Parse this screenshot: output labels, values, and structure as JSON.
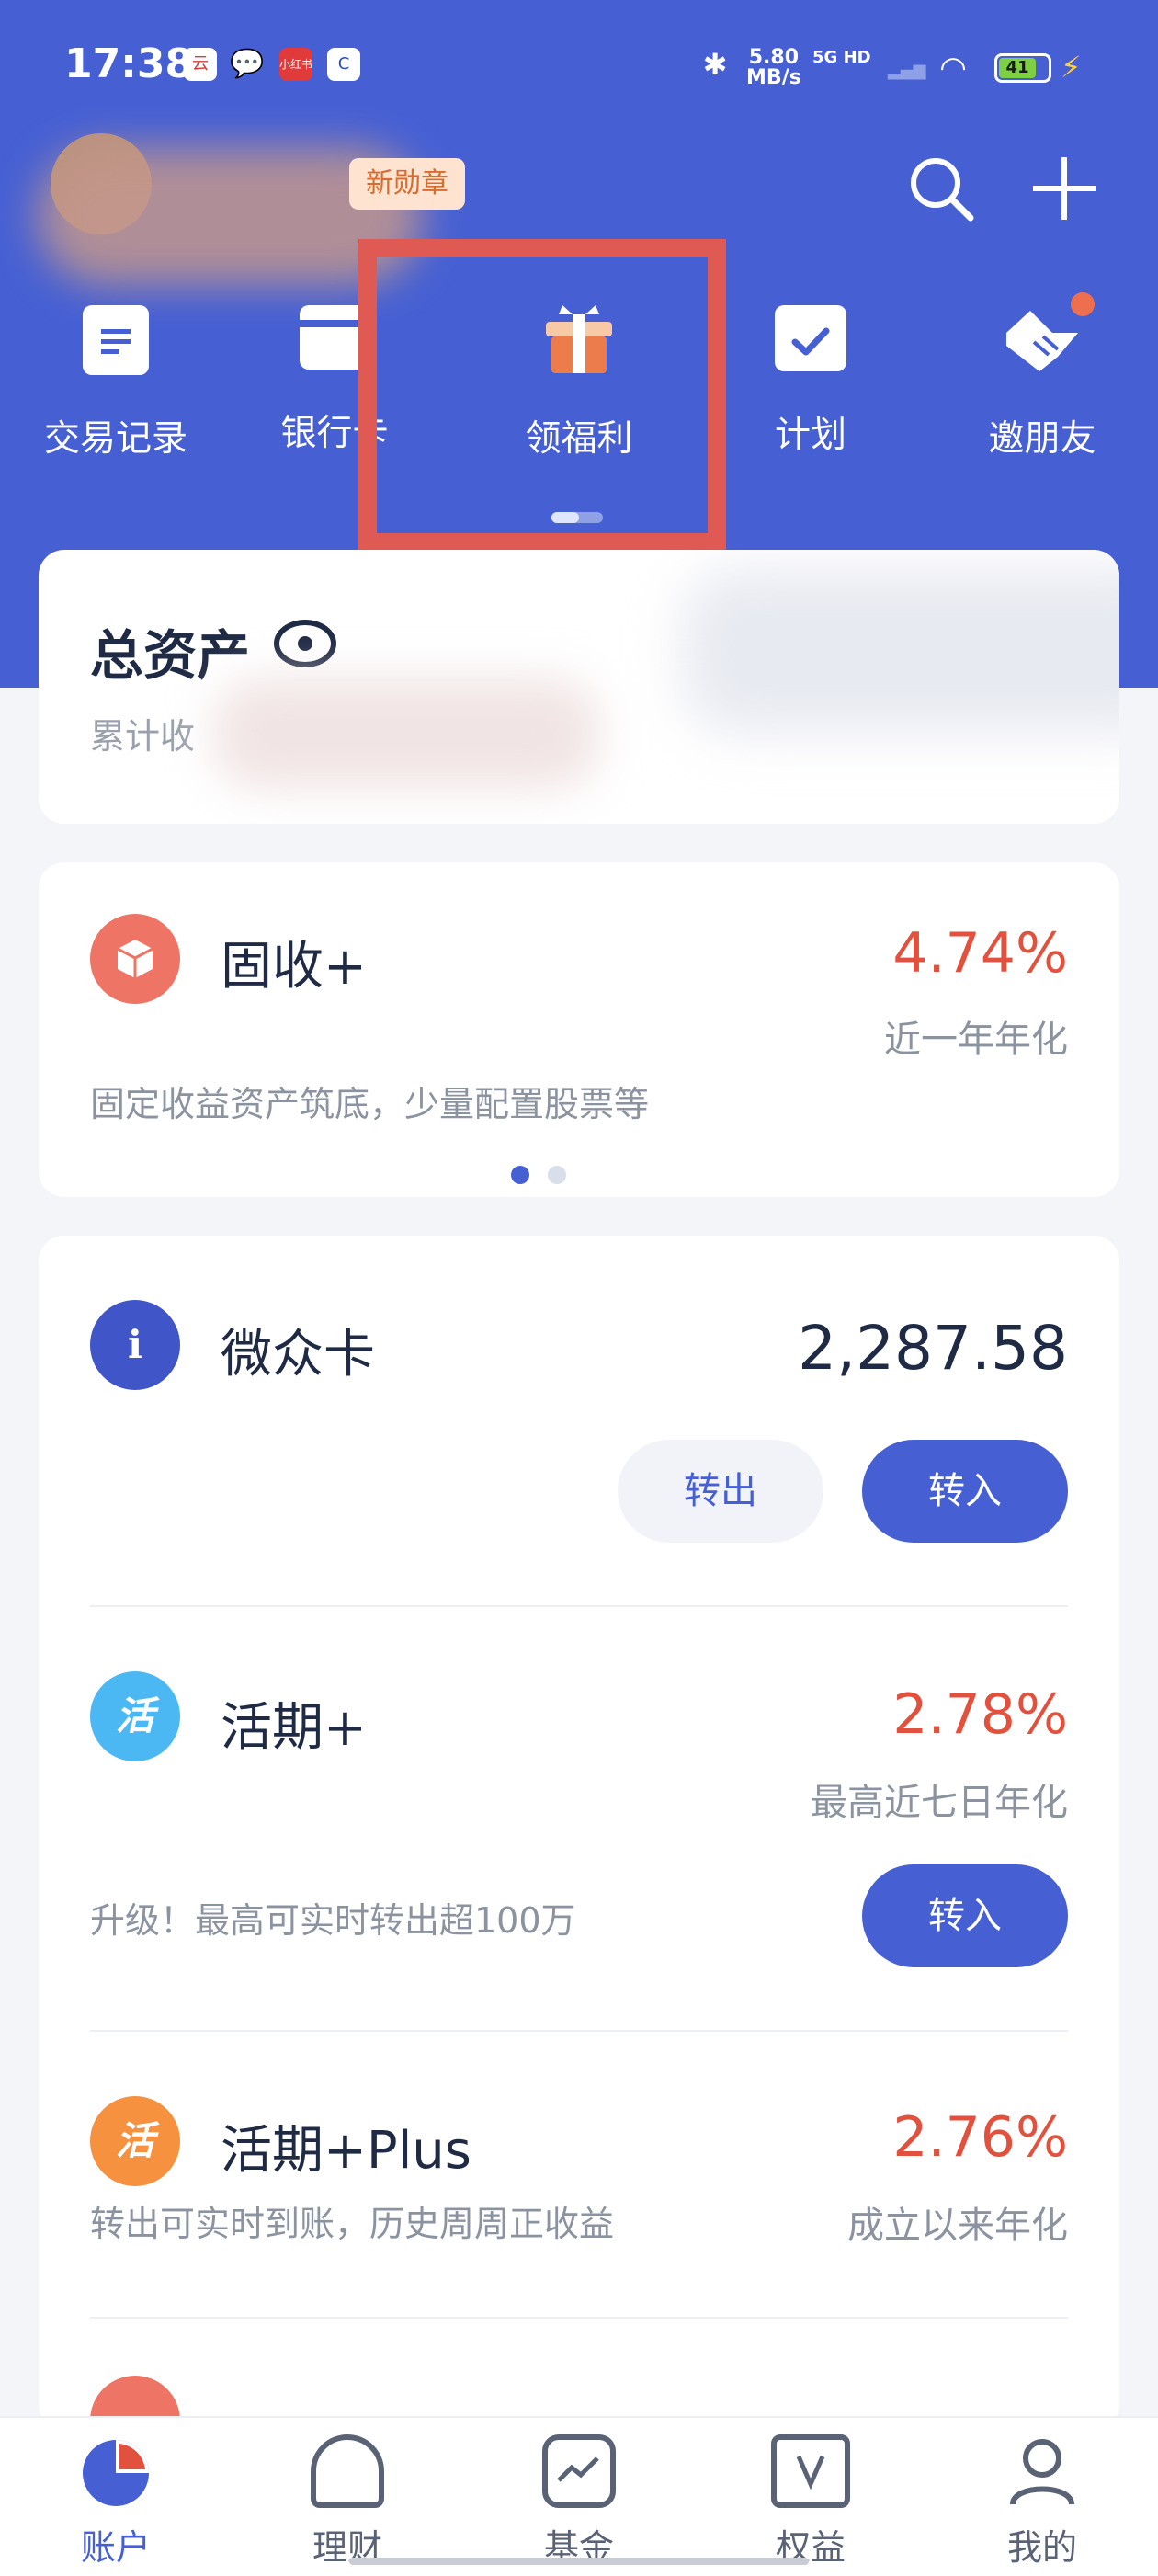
{
  "status_bar": {
    "time": "17:38",
    "net_speed_value": "5.80",
    "net_speed_unit": "MB/s",
    "signal_label": "5G HD",
    "battery": "41"
  },
  "header": {
    "badge": "新勋章"
  },
  "shortcuts": [
    {
      "label": "交易记录",
      "icon": "document-icon"
    },
    {
      "label": "银行卡",
      "icon": "bank-card-icon"
    },
    {
      "label": "领福利",
      "icon": "gift-icon"
    },
    {
      "label": "计划",
      "icon": "calendar-check-icon"
    },
    {
      "label": "邀朋友",
      "icon": "handshake-icon"
    }
  ],
  "assets": {
    "title": "总资产",
    "subtitle": "累计收"
  },
  "featured": {
    "name": "固收+",
    "rate": "4.74%",
    "rate_note": "近一年年化",
    "desc": "固定收益资产筑底，少量配置股票等"
  },
  "weizhong_card": {
    "name": "微众卡",
    "amount": "2,287.58",
    "out_label": "转出",
    "in_label": "转入"
  },
  "huoqi": {
    "name": "活期+",
    "icon_text": "活",
    "rate": "2.78%",
    "rate_note": "最高近七日年化",
    "desc": "升级！最高可实时转出超100万",
    "in_label": "转入"
  },
  "huoqi_plus": {
    "name": "活期+Plus",
    "icon_text": "活",
    "rate": "2.76%",
    "rate_note": "成立以来年化",
    "desc": "转出可实时到账，历史周周正收益"
  },
  "tabbar": [
    {
      "label": "账户",
      "icon": "pie-chart-icon",
      "active": true
    },
    {
      "label": "理财",
      "icon": "piggy-bank-icon",
      "active": false
    },
    {
      "label": "基金",
      "icon": "trend-chart-icon",
      "active": false
    },
    {
      "label": "权益",
      "icon": "vip-ticket-icon",
      "active": false
    },
    {
      "label": "我的",
      "icon": "person-icon",
      "active": false
    }
  ],
  "colors": {
    "brand_blue": "#4660d4",
    "rate_red": "#e2513e",
    "highlight_red": "#e05a54"
  }
}
